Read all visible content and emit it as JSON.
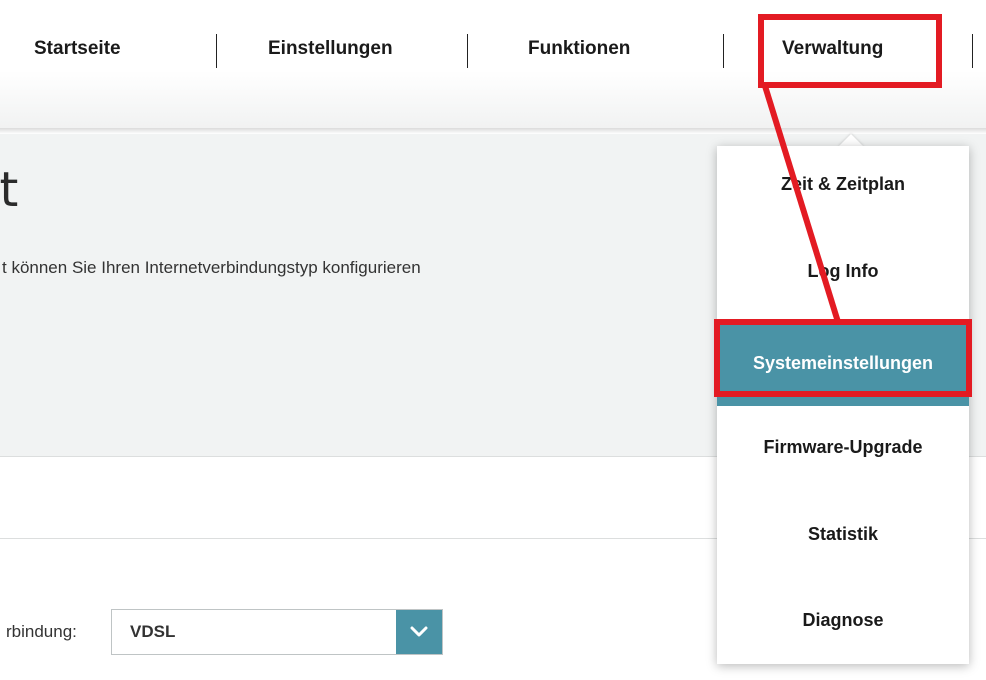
{
  "nav": {
    "items": [
      "Startseite",
      "Einstellungen",
      "Funktionen",
      "Verwaltung"
    ]
  },
  "page": {
    "title_fragment": "et",
    "description": "t können Sie Ihren Internetverbindungstyp konfigurieren"
  },
  "form": {
    "connection_label": "rbindung:",
    "connection_value": "VDSL"
  },
  "dropdown": {
    "items": [
      "Zeit & Zeitplan",
      "Log Info",
      "Systemeinstellungen",
      "Firmware-Upgrade",
      "Statistik",
      "Diagnose"
    ],
    "active_index": 2
  },
  "colors": {
    "accent": "#4a93a6",
    "annotation": "#e31b23"
  },
  "icons": {
    "select_arrow": "chevron-down-icon"
  }
}
